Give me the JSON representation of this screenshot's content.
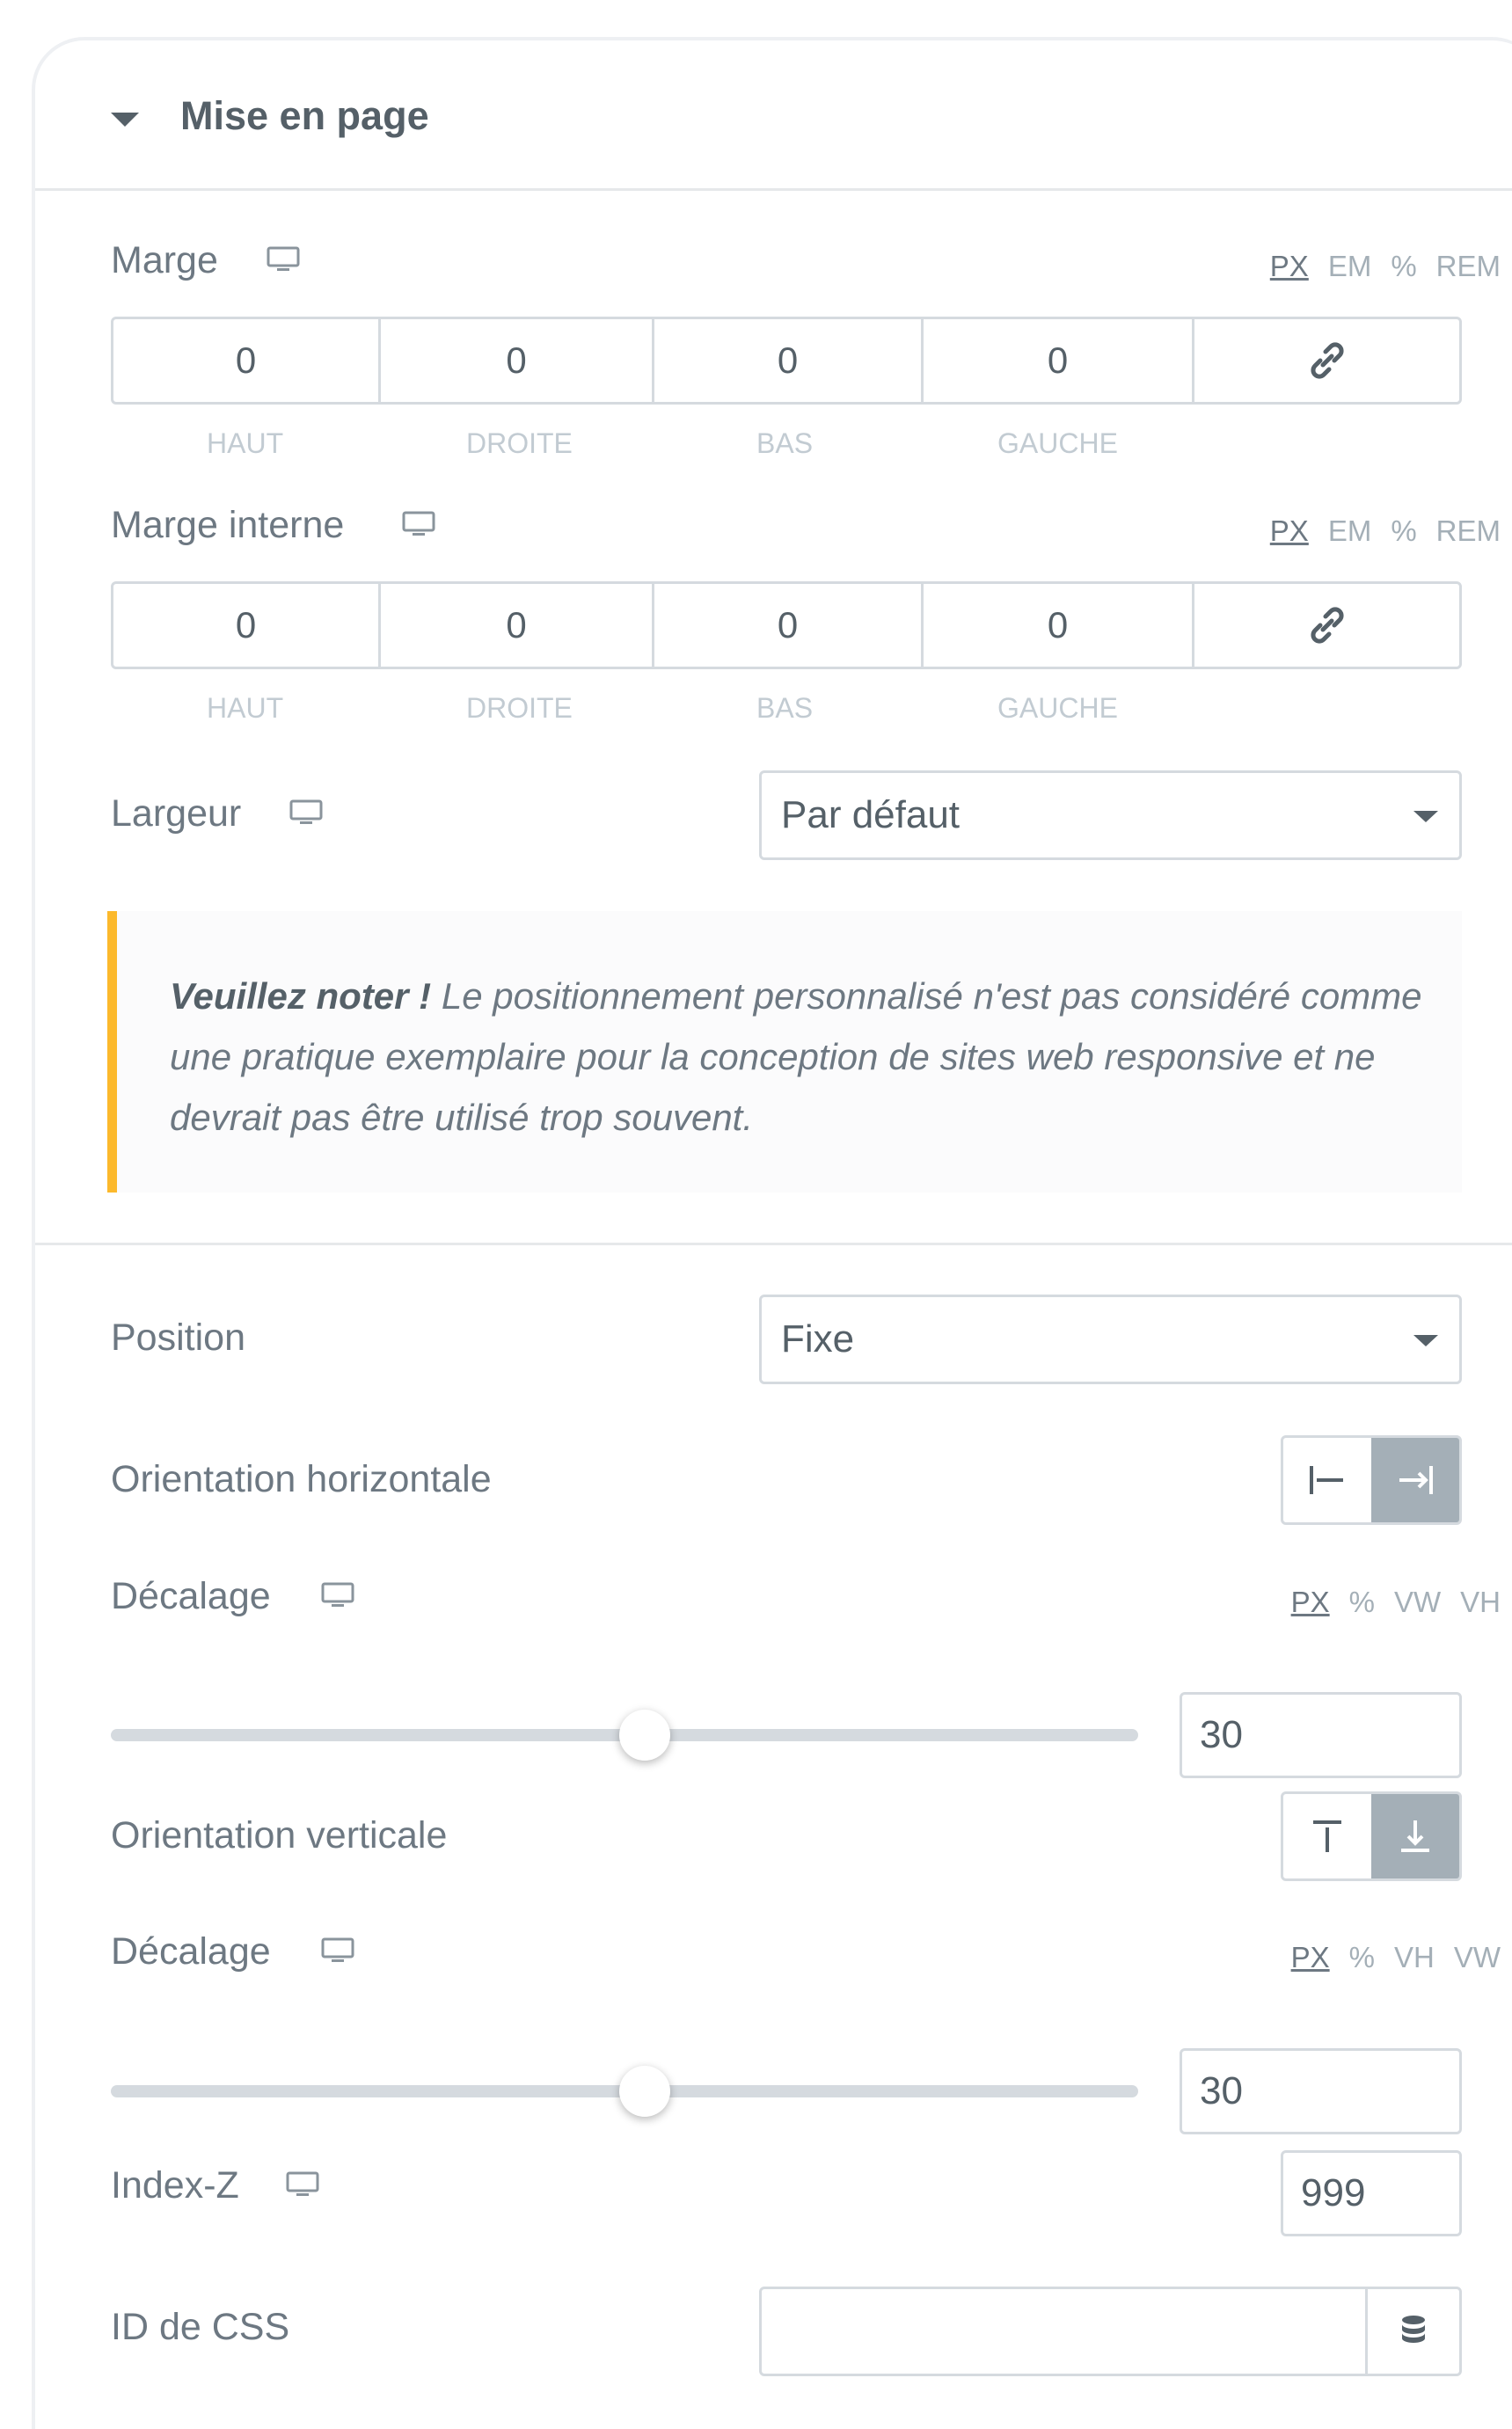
{
  "section": {
    "title": "Mise en page"
  },
  "marge": {
    "label": "Marge",
    "units": [
      "PX",
      "EM",
      "%",
      "REM"
    ],
    "values": [
      "0",
      "0",
      "0",
      "0"
    ],
    "sides": [
      "HAUT",
      "DROITE",
      "BAS",
      "GAUCHE"
    ]
  },
  "marge_interne": {
    "label": "Marge interne",
    "units": [
      "PX",
      "EM",
      "%",
      "REM"
    ],
    "values": [
      "0",
      "0",
      "0",
      "0"
    ],
    "sides": [
      "HAUT",
      "DROITE",
      "BAS",
      "GAUCHE"
    ]
  },
  "largeur": {
    "label": "Largeur",
    "value": "Par défaut"
  },
  "notice": {
    "strong": "Veuillez noter !",
    "text": " Le positionnement personnalisé n'est pas considéré comme une pratique exemplaire pour la conception de sites web responsive et ne devrait pas être utilisé trop souvent."
  },
  "position": {
    "label": "Position",
    "value": "Fixe"
  },
  "orientation_horizontale": {
    "label": "Orientation horizontale",
    "active": "right"
  },
  "decalage_h": {
    "label": "Décalage",
    "units": [
      "PX",
      "%",
      "VW",
      "VH"
    ],
    "value": "30",
    "slider_fraction": 0.52
  },
  "orientation_verticale": {
    "label": "Orientation verticale",
    "active": "bottom"
  },
  "decalage_v": {
    "label": "Décalage",
    "units": [
      "PX",
      "%",
      "VH",
      "VW"
    ],
    "value": "30",
    "slider_fraction": 0.52
  },
  "index_z": {
    "label": "Index-Z",
    "value": "999"
  },
  "css_id": {
    "label": "ID de CSS",
    "value": ""
  },
  "icons": {
    "caret": "caret-down-icon",
    "responsive": "desktop-monitor-icon",
    "link": "link-icon",
    "dropdown": "chevron-down-icon",
    "align_left": "align-start-left-icon",
    "align_right": "align-end-right-icon",
    "align_top": "align-top-icon",
    "align_bottom": "align-bottom-icon",
    "dynamic": "database-dynamic-tags-icon"
  },
  "colors": {
    "notice_accent": "#fcb92c",
    "active_toggle": "#a4afb7",
    "text": "#6d7882"
  }
}
